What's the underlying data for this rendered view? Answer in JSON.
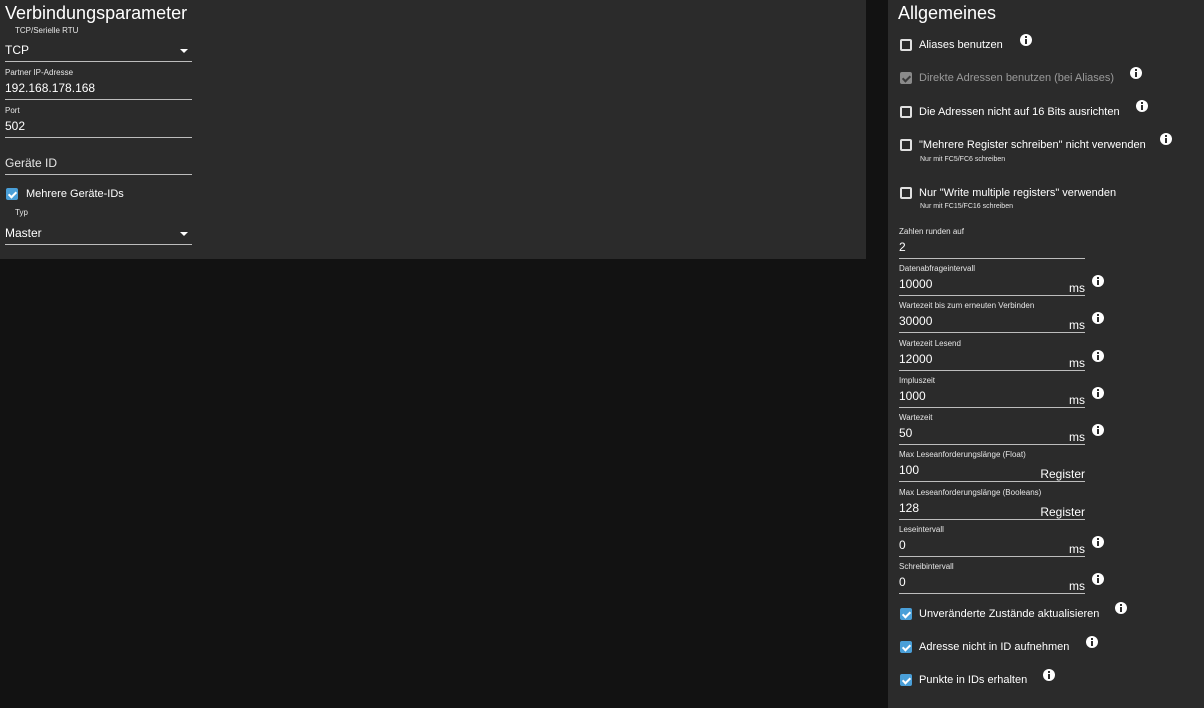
{
  "left": {
    "title": "Verbindungsparameter",
    "connection_type": {
      "label": "TCP/Serielle RTU",
      "value": "TCP"
    },
    "partner_ip": {
      "label": "Partner IP-Adresse",
      "value": "192.168.178.168"
    },
    "port": {
      "label": "Port",
      "value": "502"
    },
    "device_id": {
      "placeholder": "Geräte ID"
    },
    "multiple_ids": {
      "label": "Mehrere Geräte-IDs",
      "checked": true
    },
    "type": {
      "label": "Typ",
      "value": "Master"
    }
  },
  "right": {
    "title": "Allgemeines",
    "checkboxes": [
      {
        "label": "Aliases benutzen",
        "checked": false,
        "disabled": false
      },
      {
        "label": "Direkte Adressen benutzen (bei Aliases)",
        "checked": true,
        "disabled": true
      },
      {
        "label": "Die Adressen nicht auf 16 Bits ausrichten",
        "checked": false,
        "disabled": false
      },
      {
        "label": "\"Mehrere Register schreiben\" nicht verwenden",
        "hint": "Nur mit FC5/FC6 schreiben",
        "checked": false,
        "disabled": false
      },
      {
        "label": "Nur \"Write multiple registers\" verwenden",
        "hint": "Nur mit FC15/FC16 schreiben",
        "checked": false,
        "disabled": false
      }
    ],
    "fields": [
      {
        "label": "Zahlen runden auf",
        "value": "2",
        "unit": ""
      },
      {
        "label": "Datenabfrageintervall",
        "value": "10000",
        "unit": "ms"
      },
      {
        "label": "Wartezeit bis zum erneuten Verbinden",
        "value": "30000",
        "unit": "ms"
      },
      {
        "label": "Wartezeit Lesend",
        "value": "12000",
        "unit": "ms"
      },
      {
        "label": "Impluszeit",
        "value": "1000",
        "unit": "ms"
      },
      {
        "label": "Wartezeit",
        "value": "50",
        "unit": "ms"
      },
      {
        "label": "Max Leseanforderungslänge (Float)",
        "value": "100",
        "unit": "Register"
      },
      {
        "label": "Max Leseanforderungslänge (Booleans)",
        "value": "128",
        "unit": "Register"
      },
      {
        "label": "Leseintervall",
        "value": "0",
        "unit": "ms"
      },
      {
        "label": "Schreibintervall",
        "value": "0",
        "unit": "ms"
      }
    ],
    "bottom_checkboxes": [
      {
        "label": "Unveränderte Zustände aktualisieren",
        "checked": true
      },
      {
        "label": "Adresse nicht in ID aufnehmen",
        "checked": true
      },
      {
        "label": "Punkte in IDs erhalten",
        "checked": true
      }
    ]
  },
  "colors": {
    "panel": "#2b2b2b",
    "background": "#121212",
    "accent": "#4a9fd8"
  }
}
